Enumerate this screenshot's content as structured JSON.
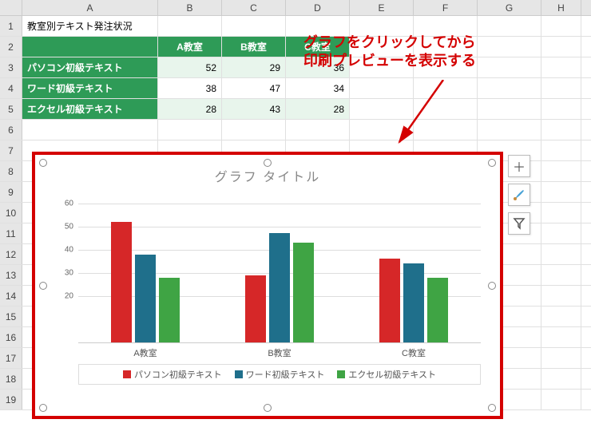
{
  "columns": [
    "A",
    "B",
    "C",
    "D",
    "E",
    "F",
    "G",
    "H"
  ],
  "rows": [
    "1",
    "2",
    "3",
    "4",
    "5",
    "6",
    "7",
    "8",
    "9",
    "10",
    "11",
    "12",
    "13",
    "14",
    "15",
    "16",
    "17",
    "18",
    "19"
  ],
  "title_cell": "教室別テキスト発注状況",
  "table": {
    "headers": [
      "A教室",
      "B教室",
      "C教室"
    ],
    "rows": [
      {
        "label": "パソコン初級テキスト",
        "vals": [
          "52",
          "29",
          "36"
        ]
      },
      {
        "label": "ワード初級テキスト",
        "vals": [
          "38",
          "47",
          "34"
        ]
      },
      {
        "label": "エクセル初級テキスト",
        "vals": [
          "28",
          "43",
          "28"
        ]
      }
    ]
  },
  "annotation": {
    "line1": "グラフをクリックしてから",
    "line2": "印刷プレビューを表示する"
  },
  "chart_data": {
    "type": "bar",
    "title": "グラフ タイトル",
    "categories": [
      "A教室",
      "B教室",
      "C教室"
    ],
    "series": [
      {
        "name": "パソコン初級テキスト",
        "values": [
          52,
          29,
          36
        ],
        "color": "#d62728"
      },
      {
        "name": "ワード初級テキスト",
        "values": [
          38,
          47,
          34
        ],
        "color": "#1f6f8b"
      },
      {
        "name": "エクセル初級テキスト",
        "values": [
          28,
          43,
          28
        ],
        "color": "#3fa444"
      }
    ],
    "ylim": [
      0,
      65
    ],
    "yticks": [
      20,
      30,
      40,
      50,
      60
    ],
    "xlabel": "",
    "ylabel": ""
  },
  "chart_tools": {
    "add_element": "+",
    "styles": "brush",
    "filter": "filter"
  }
}
